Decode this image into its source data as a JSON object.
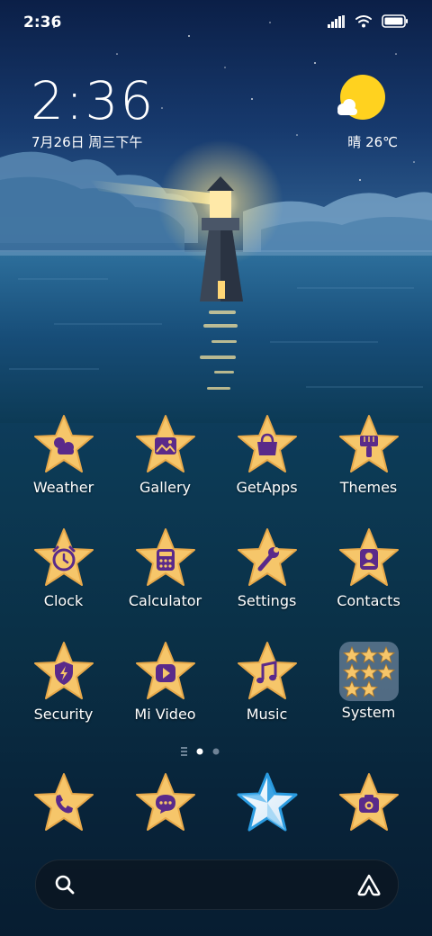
{
  "status_bar": {
    "time": "2:36",
    "icons": [
      "signal-icon",
      "wifi-icon",
      "battery-icon"
    ]
  },
  "lock_widget": {
    "time": "2:36",
    "date": "7月26日 周三下午",
    "weather_icon": "sun-cloud-icon",
    "weather_text": "晴 26℃"
  },
  "apps": [
    {
      "label": "Weather",
      "icon": "weather-icon"
    },
    {
      "label": "Gallery",
      "icon": "gallery-icon"
    },
    {
      "label": "GetApps",
      "icon": "getapps-bag-icon"
    },
    {
      "label": "Themes",
      "icon": "themes-brush-icon"
    },
    {
      "label": "Clock",
      "icon": "alarm-clock-icon"
    },
    {
      "label": "Calculator",
      "icon": "calculator-icon"
    },
    {
      "label": "Settings",
      "icon": "wrench-icon"
    },
    {
      "label": "Contacts",
      "icon": "contact-card-icon"
    },
    {
      "label": "Security",
      "icon": "shield-icon"
    },
    {
      "label": "Mi Video",
      "icon": "play-icon"
    },
    {
      "label": "Music",
      "icon": "music-note-icon"
    },
    {
      "label": "System",
      "icon": "folder-icon"
    }
  ],
  "page_indicator": {
    "pages": 2,
    "current": 1
  },
  "dock": [
    {
      "icon": "phone-icon"
    },
    {
      "icon": "message-icon"
    },
    {
      "icon": "white-star-icon"
    },
    {
      "icon": "camera-icon"
    }
  ],
  "search_bar": {
    "left_icon": "search-icon",
    "right_icon": "assistant-icon"
  },
  "colors": {
    "star_fill": "#f6c66a",
    "star_edge": "#e8a94a",
    "glyph": "#5a2a8a"
  }
}
